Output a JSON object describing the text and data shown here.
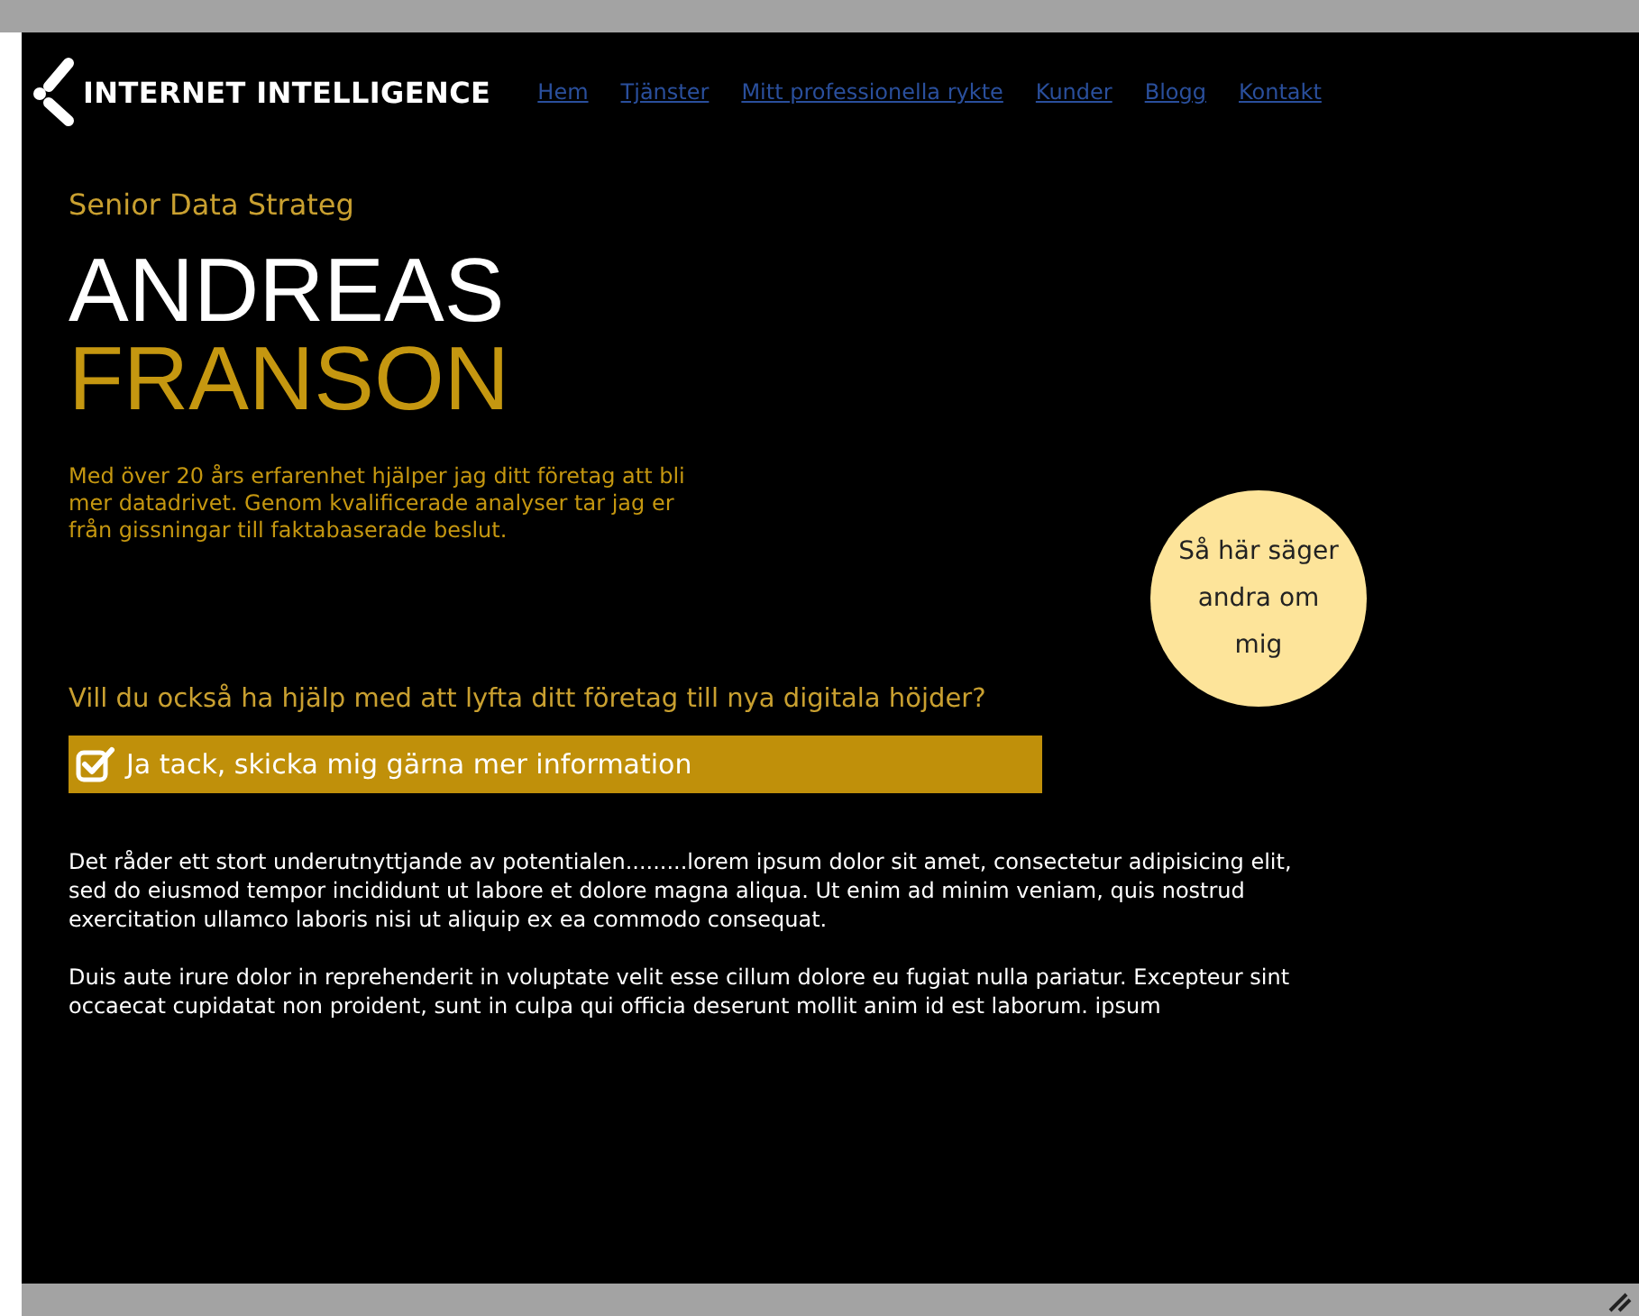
{
  "header": {
    "logo": "INTERNET INTELLIGENCE",
    "nav": [
      {
        "label": "Hem"
      },
      {
        "label": "Tjänster"
      },
      {
        "label": "Mitt professionella rykte"
      },
      {
        "label": "Kunder"
      },
      {
        "label": "Blogg"
      },
      {
        "label": "Kontakt"
      }
    ]
  },
  "hero": {
    "role": "Senior Data Strateg",
    "first_name": "ANDREAS",
    "last_name": "FRANSON",
    "intro": "Med över 20 års erfarenhet hjälper jag ditt företag att bli mer datadrivet. Genom kvalificerade analyser tar jag er från gissningar till faktabaserade beslut."
  },
  "testimonial_badge": "Så här säger andra om mig",
  "question": "Vill du också ha hjälp med att lyfta ditt företag till nya digitala höjder?",
  "consent": {
    "label": "Ja tack, skicka mig gärna mer information",
    "checked": true
  },
  "paragraphs": [
    "Det råder ett stort underutnyttjande av potentialen.........lorem ipsum dolor sit amet, consectetur adipisicing elit, sed do eiusmod tempor incididunt ut labore et dolore magna aliqua. Ut enim ad minim veniam, quis nostrud exercitation ullamco laboris nisi ut aliquip ex ea commodo consequat.",
    "Duis aute irure dolor in reprehenderit in voluptate velit esse cillum dolore eu fugiat nulla pariatur. Excepteur sint occaecat cupidatat non proident, sunt in culpa qui officia deserunt mollit anim id est laborum. ipsum"
  ]
}
